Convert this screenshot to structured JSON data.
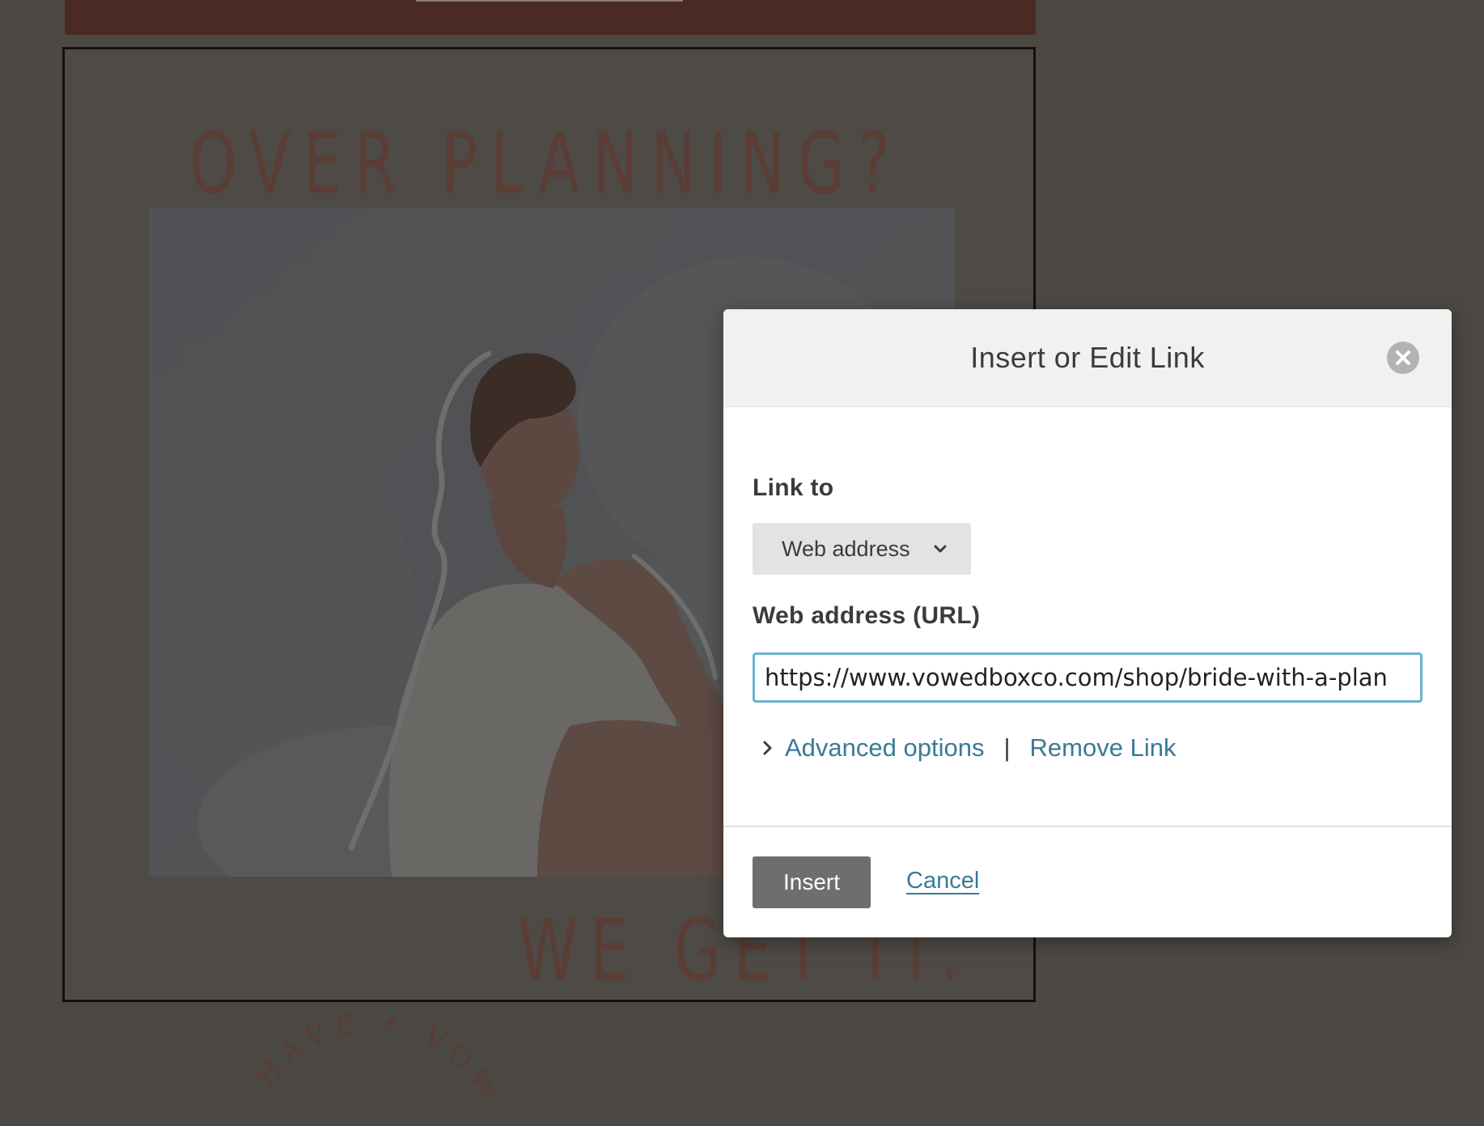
{
  "background": {
    "headline_top": "OVER PLANNING?",
    "headline_bottom": "WE GET IT.",
    "seal_text": "HAVE • VOWED"
  },
  "dialog": {
    "title": "Insert or Edit Link",
    "link_to_label": "Link to",
    "link_to_value": "Web address",
    "url_label": "Web address (URL)",
    "url_value": "https://www.vowedboxco.com/shop/bride-with-a-plan",
    "advanced_options": "Advanced options",
    "separator": "|",
    "remove_link": "Remove Link",
    "insert_label": "Insert",
    "cancel_label": "Cancel"
  },
  "colors": {
    "backdrop": "#4c4843",
    "link": "#3a7a96",
    "input_focus_border": "#6bb4cc",
    "insert_button": "#6e6e6e",
    "banner": "#4a2a23"
  },
  "icons": {
    "close": "close-circle-icon",
    "select_chevron": "chevron-down-icon",
    "advanced_chevron": "chevron-right-icon"
  }
}
